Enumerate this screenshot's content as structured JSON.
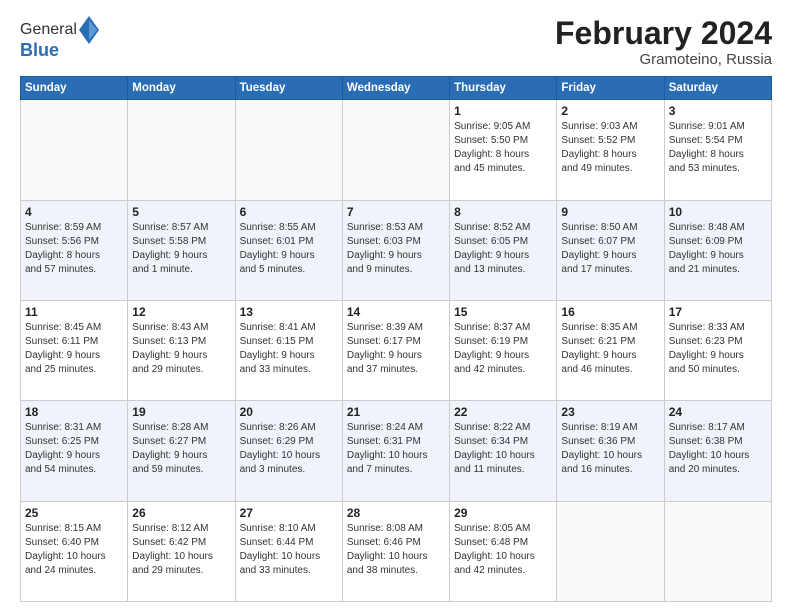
{
  "header": {
    "logo_general": "General",
    "logo_blue": "Blue",
    "month_title": "February 2024",
    "location": "Gramoteino, Russia"
  },
  "days_of_week": [
    "Sunday",
    "Monday",
    "Tuesday",
    "Wednesday",
    "Thursday",
    "Friday",
    "Saturday"
  ],
  "weeks": [
    [
      {
        "day": "",
        "info": ""
      },
      {
        "day": "",
        "info": ""
      },
      {
        "day": "",
        "info": ""
      },
      {
        "day": "",
        "info": ""
      },
      {
        "day": "1",
        "info": "Sunrise: 9:05 AM\nSunset: 5:50 PM\nDaylight: 8 hours\nand 45 minutes."
      },
      {
        "day": "2",
        "info": "Sunrise: 9:03 AM\nSunset: 5:52 PM\nDaylight: 8 hours\nand 49 minutes."
      },
      {
        "day": "3",
        "info": "Sunrise: 9:01 AM\nSunset: 5:54 PM\nDaylight: 8 hours\nand 53 minutes."
      }
    ],
    [
      {
        "day": "4",
        "info": "Sunrise: 8:59 AM\nSunset: 5:56 PM\nDaylight: 8 hours\nand 57 minutes."
      },
      {
        "day": "5",
        "info": "Sunrise: 8:57 AM\nSunset: 5:58 PM\nDaylight: 9 hours\nand 1 minute."
      },
      {
        "day": "6",
        "info": "Sunrise: 8:55 AM\nSunset: 6:01 PM\nDaylight: 9 hours\nand 5 minutes."
      },
      {
        "day": "7",
        "info": "Sunrise: 8:53 AM\nSunset: 6:03 PM\nDaylight: 9 hours\nand 9 minutes."
      },
      {
        "day": "8",
        "info": "Sunrise: 8:52 AM\nSunset: 6:05 PM\nDaylight: 9 hours\nand 13 minutes."
      },
      {
        "day": "9",
        "info": "Sunrise: 8:50 AM\nSunset: 6:07 PM\nDaylight: 9 hours\nand 17 minutes."
      },
      {
        "day": "10",
        "info": "Sunrise: 8:48 AM\nSunset: 6:09 PM\nDaylight: 9 hours\nand 21 minutes."
      }
    ],
    [
      {
        "day": "11",
        "info": "Sunrise: 8:45 AM\nSunset: 6:11 PM\nDaylight: 9 hours\nand 25 minutes."
      },
      {
        "day": "12",
        "info": "Sunrise: 8:43 AM\nSunset: 6:13 PM\nDaylight: 9 hours\nand 29 minutes."
      },
      {
        "day": "13",
        "info": "Sunrise: 8:41 AM\nSunset: 6:15 PM\nDaylight: 9 hours\nand 33 minutes."
      },
      {
        "day": "14",
        "info": "Sunrise: 8:39 AM\nSunset: 6:17 PM\nDaylight: 9 hours\nand 37 minutes."
      },
      {
        "day": "15",
        "info": "Sunrise: 8:37 AM\nSunset: 6:19 PM\nDaylight: 9 hours\nand 42 minutes."
      },
      {
        "day": "16",
        "info": "Sunrise: 8:35 AM\nSunset: 6:21 PM\nDaylight: 9 hours\nand 46 minutes."
      },
      {
        "day": "17",
        "info": "Sunrise: 8:33 AM\nSunset: 6:23 PM\nDaylight: 9 hours\nand 50 minutes."
      }
    ],
    [
      {
        "day": "18",
        "info": "Sunrise: 8:31 AM\nSunset: 6:25 PM\nDaylight: 9 hours\nand 54 minutes."
      },
      {
        "day": "19",
        "info": "Sunrise: 8:28 AM\nSunset: 6:27 PM\nDaylight: 9 hours\nand 59 minutes."
      },
      {
        "day": "20",
        "info": "Sunrise: 8:26 AM\nSunset: 6:29 PM\nDaylight: 10 hours\nand 3 minutes."
      },
      {
        "day": "21",
        "info": "Sunrise: 8:24 AM\nSunset: 6:31 PM\nDaylight: 10 hours\nand 7 minutes."
      },
      {
        "day": "22",
        "info": "Sunrise: 8:22 AM\nSunset: 6:34 PM\nDaylight: 10 hours\nand 11 minutes."
      },
      {
        "day": "23",
        "info": "Sunrise: 8:19 AM\nSunset: 6:36 PM\nDaylight: 10 hours\nand 16 minutes."
      },
      {
        "day": "24",
        "info": "Sunrise: 8:17 AM\nSunset: 6:38 PM\nDaylight: 10 hours\nand 20 minutes."
      }
    ],
    [
      {
        "day": "25",
        "info": "Sunrise: 8:15 AM\nSunset: 6:40 PM\nDaylight: 10 hours\nand 24 minutes."
      },
      {
        "day": "26",
        "info": "Sunrise: 8:12 AM\nSunset: 6:42 PM\nDaylight: 10 hours\nand 29 minutes."
      },
      {
        "day": "27",
        "info": "Sunrise: 8:10 AM\nSunset: 6:44 PM\nDaylight: 10 hours\nand 33 minutes."
      },
      {
        "day": "28",
        "info": "Sunrise: 8:08 AM\nSunset: 6:46 PM\nDaylight: 10 hours\nand 38 minutes."
      },
      {
        "day": "29",
        "info": "Sunrise: 8:05 AM\nSunset: 6:48 PM\nDaylight: 10 hours\nand 42 minutes."
      },
      {
        "day": "",
        "info": ""
      },
      {
        "day": "",
        "info": ""
      }
    ]
  ]
}
